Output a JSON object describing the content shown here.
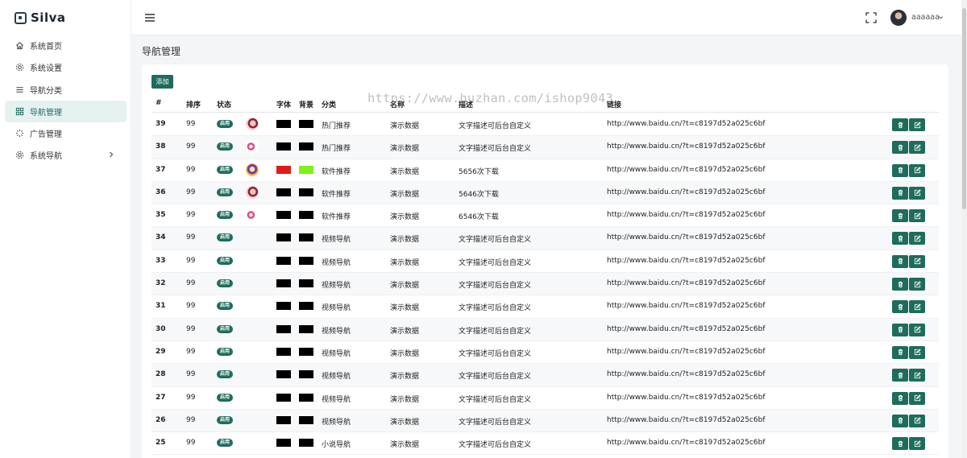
{
  "brand": {
    "name": "Silva"
  },
  "sidebar": {
    "items": [
      {
        "label": "系统首页",
        "icon": "home-icon"
      },
      {
        "label": "系统设置",
        "icon": "gear-icon"
      },
      {
        "label": "导航分类",
        "icon": "list-icon"
      },
      {
        "label": "导航管理",
        "icon": "grid-icon",
        "active": true
      },
      {
        "label": "广告管理",
        "icon": "loader-icon"
      },
      {
        "label": "系统导航",
        "icon": "gear-icon",
        "has_children": true
      }
    ]
  },
  "header": {
    "username": "aaaaaa"
  },
  "page": {
    "title": "导航管理",
    "add_label": "添加"
  },
  "table": {
    "columns": [
      "#",
      "排序",
      "状态",
      "字体",
      "背景",
      "分类",
      "名称",
      "描述",
      "链接"
    ],
    "status_label": "启用",
    "rows": [
      {
        "id": "39",
        "sort": "99",
        "thumb": "a",
        "font": "#000000",
        "bg": "#000000",
        "cat": "热门推荐",
        "name": "演示数据",
        "desc": "文字描述可后台自定义",
        "link": "http://www.baidu.cn/?t=c8197d52a025c6bf"
      },
      {
        "id": "38",
        "sort": "99",
        "thumb": "b",
        "font": "#000000",
        "bg": "#000000",
        "cat": "热门推荐",
        "name": "演示数据",
        "desc": "文字描述可后台自定义",
        "link": "http://www.baidu.cn/?t=c8197d52a025c6bf"
      },
      {
        "id": "37",
        "sort": "99",
        "thumb": "c",
        "font": "#e01b1b",
        "bg": "#7ef01a",
        "cat": "软件推荐",
        "name": "演示数据",
        "desc": "5656次下载",
        "link": "http://www.baidu.cn/?t=c8197d52a025c6bf"
      },
      {
        "id": "36",
        "sort": "99",
        "thumb": "a",
        "font": "#000000",
        "bg": "#000000",
        "cat": "软件推荐",
        "name": "演示数据",
        "desc": "5646次下载",
        "link": "http://www.baidu.cn/?t=c8197d52a025c6bf"
      },
      {
        "id": "35",
        "sort": "99",
        "thumb": "b",
        "font": "#000000",
        "bg": "#000000",
        "cat": "软件推荐",
        "name": "演示数据",
        "desc": "6546次下载",
        "link": "http://www.baidu.cn/?t=c8197d52a025c6bf"
      },
      {
        "id": "34",
        "sort": "99",
        "thumb": "",
        "font": "#000000",
        "bg": "#000000",
        "cat": "视频导航",
        "name": "演示数据",
        "desc": "文字描述可后台自定义",
        "link": "http://www.baidu.cn/?t=c8197d52a025c6bf"
      },
      {
        "id": "33",
        "sort": "99",
        "thumb": "",
        "font": "#000000",
        "bg": "#000000",
        "cat": "视频导航",
        "name": "演示数据",
        "desc": "文字描述可后台自定义",
        "link": "http://www.baidu.cn/?t=c8197d52a025c6bf"
      },
      {
        "id": "32",
        "sort": "99",
        "thumb": "",
        "font": "#000000",
        "bg": "#000000",
        "cat": "视频导航",
        "name": "演示数据",
        "desc": "文字描述可后台自定义",
        "link": "http://www.baidu.cn/?t=c8197d52a025c6bf"
      },
      {
        "id": "31",
        "sort": "99",
        "thumb": "",
        "font": "#000000",
        "bg": "#000000",
        "cat": "视频导航",
        "name": "演示数据",
        "desc": "文字描述可后台自定义",
        "link": "http://www.baidu.cn/?t=c8197d52a025c6bf"
      },
      {
        "id": "30",
        "sort": "99",
        "thumb": "",
        "font": "#000000",
        "bg": "#000000",
        "cat": "视频导航",
        "name": "演示数据",
        "desc": "文字描述可后台自定义",
        "link": "http://www.baidu.cn/?t=c8197d52a025c6bf"
      },
      {
        "id": "29",
        "sort": "99",
        "thumb": "",
        "font": "#000000",
        "bg": "#000000",
        "cat": "视频导航",
        "name": "演示数据",
        "desc": "文字描述可后台自定义",
        "link": "http://www.baidu.cn/?t=c8197d52a025c6bf"
      },
      {
        "id": "28",
        "sort": "99",
        "thumb": "",
        "font": "#000000",
        "bg": "#000000",
        "cat": "视频导航",
        "name": "演示数据",
        "desc": "文字描述可后台自定义",
        "link": "http://www.baidu.cn/?t=c8197d52a025c6bf"
      },
      {
        "id": "27",
        "sort": "99",
        "thumb": "",
        "font": "#000000",
        "bg": "#000000",
        "cat": "视频导航",
        "name": "演示数据",
        "desc": "文字描述可后台自定义",
        "link": "http://www.baidu.cn/?t=c8197d52a025c6bf"
      },
      {
        "id": "26",
        "sort": "99",
        "thumb": "",
        "font": "#000000",
        "bg": "#000000",
        "cat": "视频导航",
        "name": "演示数据",
        "desc": "文字描述可后台自定义",
        "link": "http://www.baidu.cn/?t=c8197d52a025c6bf"
      },
      {
        "id": "25",
        "sort": "99",
        "thumb": "",
        "font": "#000000",
        "bg": "#000000",
        "cat": "小说导航",
        "name": "演示数据",
        "desc": "文字描述可后台自定义",
        "link": "http://www.baidu.cn/?t=c8197d52a025c6bf"
      }
    ]
  },
  "watermark": "https://www.huzhan.com/ishop9043",
  "colors": {
    "accent": "#1e6c5c",
    "active_bg": "#e6f2ef",
    "page_bg": "#f4f5f7"
  }
}
